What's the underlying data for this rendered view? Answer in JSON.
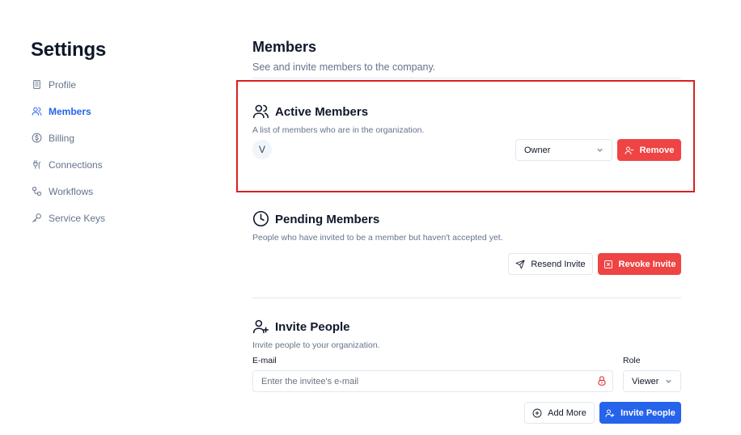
{
  "sidebar": {
    "title": "Settings",
    "items": [
      {
        "label": "Profile",
        "icon": "building-icon"
      },
      {
        "label": "Members",
        "icon": "users-icon",
        "active": true
      },
      {
        "label": "Billing",
        "icon": "dollar-icon"
      },
      {
        "label": "Connections",
        "icon": "plug-icon"
      },
      {
        "label": "Workflows",
        "icon": "workflow-icon"
      },
      {
        "label": "Service Keys",
        "icon": "key-icon"
      }
    ]
  },
  "page": {
    "title": "Members",
    "subtitle": "See and invite members to the company."
  },
  "active_members": {
    "title": "Active Members",
    "description": "A list of members who are in the organization.",
    "members": [
      {
        "initial": "V",
        "role": "Owner",
        "remove_label": "Remove"
      }
    ]
  },
  "pending_members": {
    "title": "Pending Members",
    "description": "People who have invited to be a member but haven't accepted yet.",
    "resend_label": "Resend Invite",
    "revoke_label": "Revoke Invite"
  },
  "invite": {
    "title": "Invite People",
    "description": "Invite people to your organization.",
    "email_label": "E-mail",
    "email_placeholder": "Enter the invitee's e-mail",
    "email_value": "",
    "role_label": "Role",
    "role_value": "Viewer",
    "add_more_label": "Add More",
    "invite_label": "Invite People"
  },
  "colors": {
    "accent": "#2563eb",
    "danger": "#ef4444",
    "highlight": "#d92121"
  }
}
